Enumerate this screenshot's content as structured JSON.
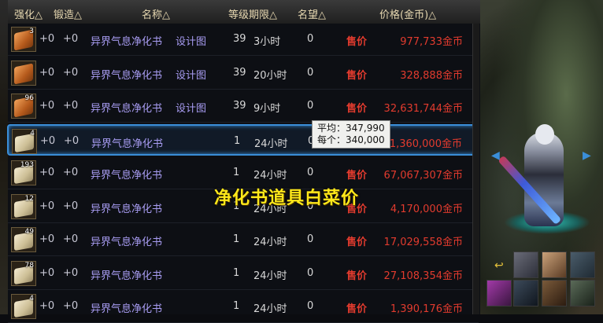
{
  "header": {
    "col_enhance": "强化△",
    "col_forge": "锻造△",
    "col_name": "名称△",
    "col_level_duration": "等级期限△",
    "col_reputation": "名望△",
    "col_price": "价格(金币)△"
  },
  "rows": [
    {
      "qty": "3",
      "enhance": "+0",
      "forge": "+0",
      "name": "异界气息净化书",
      "blueprint": "设计图",
      "level": "39",
      "time": "3小时",
      "rep": "0",
      "action": "售价",
      "price": "977,733",
      "unit": "金币",
      "icon": "orange-scroll"
    },
    {
      "qty": "",
      "enhance": "+0",
      "forge": "+0",
      "name": "异界气息净化书",
      "blueprint": "设计图",
      "level": "39",
      "time": "20小时",
      "rep": "0",
      "action": "售价",
      "price": "328,888",
      "unit": "金币",
      "icon": "orange-scroll"
    },
    {
      "qty": "96",
      "enhance": "+0",
      "forge": "+0",
      "name": "异界气息净化书",
      "blueprint": "设计图",
      "level": "39",
      "time": "9小时",
      "rep": "0",
      "action": "售价",
      "price": "32,631,744",
      "unit": "金币",
      "icon": "orange-scroll"
    },
    {
      "qty": "4",
      "enhance": "+0",
      "forge": "+0",
      "name": "异界气息净化书",
      "blueprint": "",
      "level": "1",
      "time": "24小时",
      "rep": "0",
      "action": "",
      "price": "1,360,000",
      "unit": "金币",
      "icon": "pale-scroll"
    },
    {
      "qty": "193",
      "enhance": "+0",
      "forge": "+0",
      "name": "异界气息净化书",
      "blueprint": "",
      "level": "1",
      "time": "24小时",
      "rep": "0",
      "action": "售价",
      "price": "67,067,307",
      "unit": "金币",
      "icon": "pale-scroll"
    },
    {
      "qty": "12",
      "enhance": "+0",
      "forge": "+0",
      "name": "异界气息净化书",
      "blueprint": "",
      "level": "1",
      "time": "24小时",
      "rep": "0",
      "action": "售价",
      "price": "4,170,000",
      "unit": "金币",
      "icon": "pale-scroll"
    },
    {
      "qty": "49",
      "enhance": "+0",
      "forge": "+0",
      "name": "异界气息净化书",
      "blueprint": "",
      "level": "1",
      "time": "24小时",
      "rep": "0",
      "action": "售价",
      "price": "17,029,558",
      "unit": "金币",
      "icon": "pale-scroll"
    },
    {
      "qty": "78",
      "enhance": "+0",
      "forge": "+0",
      "name": "异界气息净化书",
      "blueprint": "",
      "level": "1",
      "time": "24小时",
      "rep": "0",
      "action": "售价",
      "price": "27,108,354",
      "unit": "金币",
      "icon": "pale-scroll"
    },
    {
      "qty": "4",
      "enhance": "+0",
      "forge": "+0",
      "name": "异界气息净化书",
      "blueprint": "",
      "level": "1",
      "time": "24小时",
      "rep": "0",
      "action": "售价",
      "price": "1,390,176",
      "unit": "金币",
      "icon": "pale-scroll"
    }
  ],
  "tooltip": {
    "avg": "平均：347,990",
    "each": "每个：340,000"
  },
  "overlay_title": "净化书道具白菜价",
  "colors": {
    "accent": "#3a8ed8",
    "price": "#e23b2e",
    "item_name": "#a89cf2",
    "overlay": "#ffe81a"
  }
}
